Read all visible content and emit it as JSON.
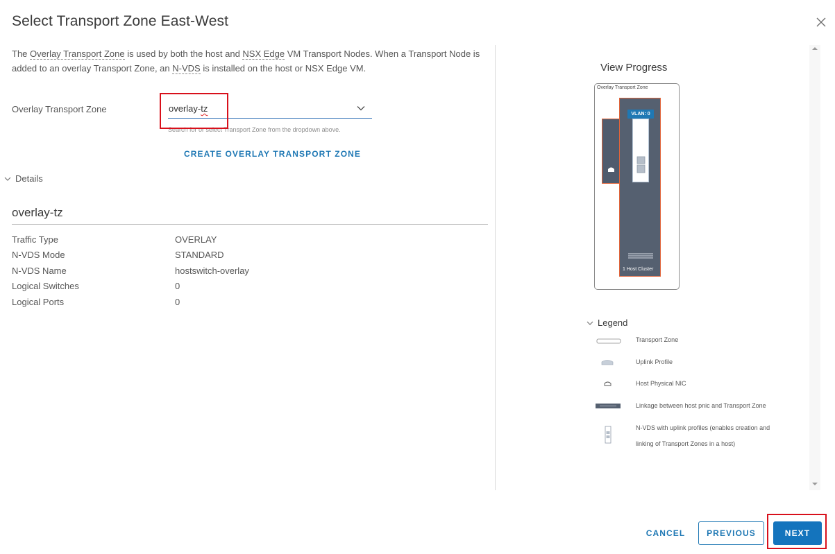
{
  "dialog": {
    "title": "Select Transport Zone East-West"
  },
  "description": {
    "p1": "The ",
    "link1": "Overlay Transport Zone",
    "p2": " is used by both the host and ",
    "link2": "NSX Edge",
    "p3": " VM Transport Nodes. When a Transport Node is added to an overlay Transport Zone, an ",
    "link3": "N-VDS",
    "p4": " is installed on the host or NSX Edge VM."
  },
  "form": {
    "field_label": "Overlay Transport Zone",
    "select_value_prefix": "overlay-",
    "select_value_suffix": "tz",
    "hint": "Search for or select Transport Zone from the dropdown above.",
    "create_link": "CREATE OVERLAY TRANSPORT ZONE"
  },
  "details": {
    "toggle_label": "Details",
    "name": "overlay-tz",
    "rows": [
      {
        "key": "Traffic Type",
        "value": "OVERLAY"
      },
      {
        "key": "N-VDS Mode",
        "value": "STANDARD"
      },
      {
        "key": "N-VDS Name",
        "value": "hostswitch-overlay"
      },
      {
        "key": "Logical Switches",
        "value": "0"
      },
      {
        "key": "Logical Ports",
        "value": "0"
      }
    ]
  },
  "progress": {
    "title": "View Progress",
    "card_label": "Overlay Transport Zone",
    "vlan_badge": "VLAN: 0",
    "cluster_label": "1 Host Cluster"
  },
  "legend": {
    "toggle_label": "Legend",
    "items": [
      {
        "icon": "transport-zone-icon",
        "label": "Transport Zone"
      },
      {
        "icon": "uplink-profile-icon",
        "label": "Uplink Profile"
      },
      {
        "icon": "host-physical-nic-icon",
        "label": "Host Physical NIC"
      },
      {
        "icon": "linkage-icon",
        "label": "Linkage between host pnic and Transport Zone"
      },
      {
        "icon": "nvds-icon",
        "label_line1": "N-VDS with uplink profiles (enables creation and",
        "label_line2": "linking of Transport Zones in a host)"
      }
    ]
  },
  "footer": {
    "cancel": "CANCEL",
    "previous": "PREVIOUS",
    "next": "NEXT"
  },
  "colors": {
    "accent": "#1474bd",
    "highlight": "#d8101b",
    "diagram_host": "#556070",
    "diagram_border": "#e0643a"
  }
}
